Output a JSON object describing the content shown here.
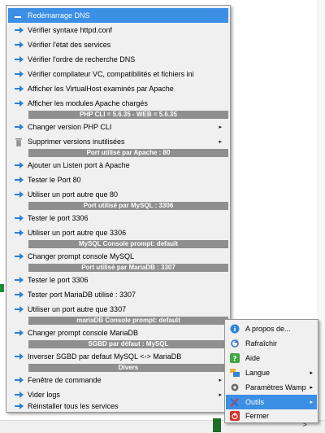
{
  "menu": {
    "items": [
      {
        "label": "Redémarrage DNS",
        "icon": "arrow-icon"
      },
      {
        "label": "Vérifier syntaxe httpd.conf",
        "icon": "arrow-icon"
      },
      {
        "label": "Vérifier l'état des services",
        "icon": "arrow-icon"
      },
      {
        "label": "Vérifier l'ordre de recherche DNS",
        "icon": "arrow-icon"
      },
      {
        "label": "Vérifier compilateur VC, compatibilités et fichiers ini",
        "icon": "arrow-icon"
      },
      {
        "label": "Afficher les VirtualHost examinés par Apache",
        "icon": "arrow-icon"
      },
      {
        "label": "Afficher les modules Apache chargés",
        "icon": "arrow-icon"
      },
      {
        "label": "Changer  version PHP CLI",
        "icon": "arrow-icon"
      },
      {
        "label": "Supprimer versions inutilisées",
        "icon": "trash-icon"
      },
      {
        "label": "Ajouter un Listen port à Apache",
        "icon": "arrow-icon"
      },
      {
        "label": "Tester le Port 80",
        "icon": "arrow-icon"
      },
      {
        "label": "Utiliser un port autre que 80",
        "icon": "arrow-icon"
      },
      {
        "label": "Tester le port 3306",
        "icon": "arrow-icon"
      },
      {
        "label": "Utiliser un port autre que 3306",
        "icon": "arrow-icon"
      },
      {
        "label": "Changer prompt console MySQL",
        "icon": "arrow-icon"
      },
      {
        "label": "Tester le port 3306",
        "icon": "arrow-icon"
      },
      {
        "label": "Tester port MariaDB utilisé : 3307",
        "icon": "arrow-icon"
      },
      {
        "label": "Utiliser un port autre que 3307",
        "icon": "arrow-icon"
      },
      {
        "label": "Changer prompt console MariaDB",
        "icon": "arrow-icon"
      },
      {
        "label": "Inverser SGBD par defaut MySQL <-> MariaDB",
        "icon": "arrow-icon"
      },
      {
        "label": "Fenêtre de commande",
        "icon": "arrow-icon"
      },
      {
        "label": "Vider logs",
        "icon": "arrow-icon"
      },
      {
        "label": "Réinstaller tous les services",
        "icon": "arrow-icon"
      }
    ],
    "headers": [
      "PHP CLI = 5.6.35 - WEB = 5.6.35",
      "Port utilisé par Apache : 80",
      "Port utilisé par MySQL : 3306",
      "MySQL Console prompt: default",
      "Port utilisé par MariaDB : 3307",
      "mariaDB Console prompt: default",
      "SGBD par défaut : MySQL",
      "Divers"
    ],
    "submenu_arrow": "▸"
  },
  "tray_menu": {
    "items": [
      {
        "label": "A propos de...",
        "icon": "info-icon"
      },
      {
        "label": "Rafraîchir",
        "icon": "refresh-icon"
      },
      {
        "label": "Aide",
        "icon": "help-icon"
      },
      {
        "label": "Langue",
        "icon": "language-icon"
      },
      {
        "label": "Paramètres Wamp",
        "icon": "settings-icon"
      },
      {
        "label": "Outils",
        "icon": "tools-icon"
      },
      {
        "label": "Fermer",
        "icon": "power-icon"
      }
    ]
  },
  "taskbar": {
    "scroll_arrow": ">"
  },
  "colors": {
    "highlight": "#3b8fe4",
    "header_bg": "#8f8f8f",
    "menu_bg": "#f0f0f0",
    "arrow_icon": "#2f7fd0"
  }
}
